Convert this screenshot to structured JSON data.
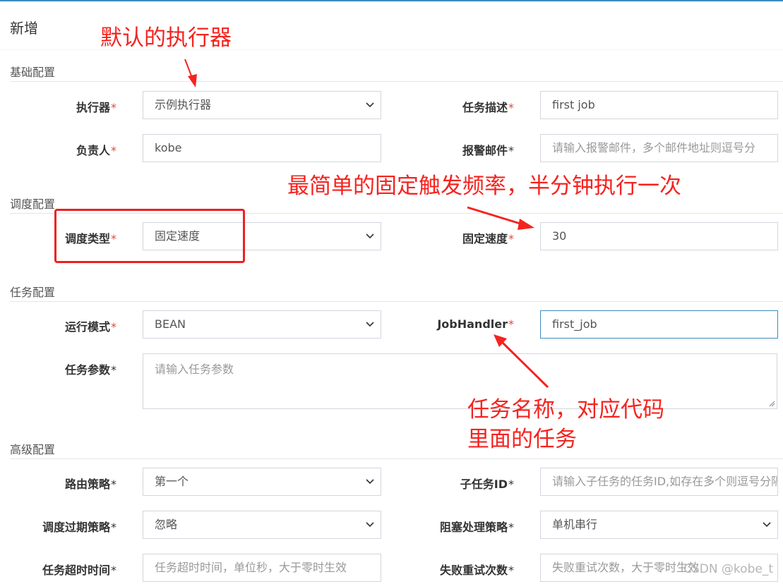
{
  "header": {
    "title": "新增"
  },
  "sections": {
    "basic": "基础配置",
    "schedule": "调度配置",
    "task": "任务配置",
    "advanced": "高级配置"
  },
  "fields": {
    "executor": {
      "label": "执行器",
      "value": "示例执行器"
    },
    "jobDesc": {
      "label": "任务描述",
      "value": "first job"
    },
    "author": {
      "label": "负责人",
      "value": "kobe"
    },
    "alarmEmail": {
      "label": "报警邮件",
      "placeholder": "请输入报警邮件，多个邮件地址则逗号分"
    },
    "scheduleType": {
      "label": "调度类型",
      "value": "固定速度"
    },
    "fixRate": {
      "label": "固定速度",
      "value": "30"
    },
    "glueType": {
      "label": "运行模式",
      "value": "BEAN"
    },
    "jobHandler": {
      "label": "JobHandler",
      "value": "first_job"
    },
    "jobParam": {
      "label": "任务参数",
      "placeholder": "请输入任务参数"
    },
    "routeStrategy": {
      "label": "路由策略",
      "value": "第一个"
    },
    "childJobId": {
      "label": "子任务ID",
      "placeholder": "请输入子任务的任务ID,如存在多个则逗号分隔"
    },
    "misfireStrategy": {
      "label": "调度过期策略",
      "value": "忽略"
    },
    "blockStrategy": {
      "label": "阻塞处理策略",
      "value": "单机串行"
    },
    "timeout": {
      "label": "任务超时时间",
      "placeholder": "任务超时时间，单位秒，大于零时生效"
    },
    "failRetry": {
      "label": "失败重试次数",
      "placeholder": "失败重试次数，大于零时生效"
    }
  },
  "required_mark": "*",
  "annotations": {
    "a1": "默认的执行器",
    "a2": "最简单的固定触发频率，半分钟执行一次",
    "a3_line1": "任务名称，对应代码",
    "a3_line2": "里面的任务"
  },
  "watermark": "CSDN @kobe_t",
  "colors": {
    "required": "#dd4b39",
    "annotation": "#f5231f",
    "focus_border": "#3c8dbc"
  }
}
